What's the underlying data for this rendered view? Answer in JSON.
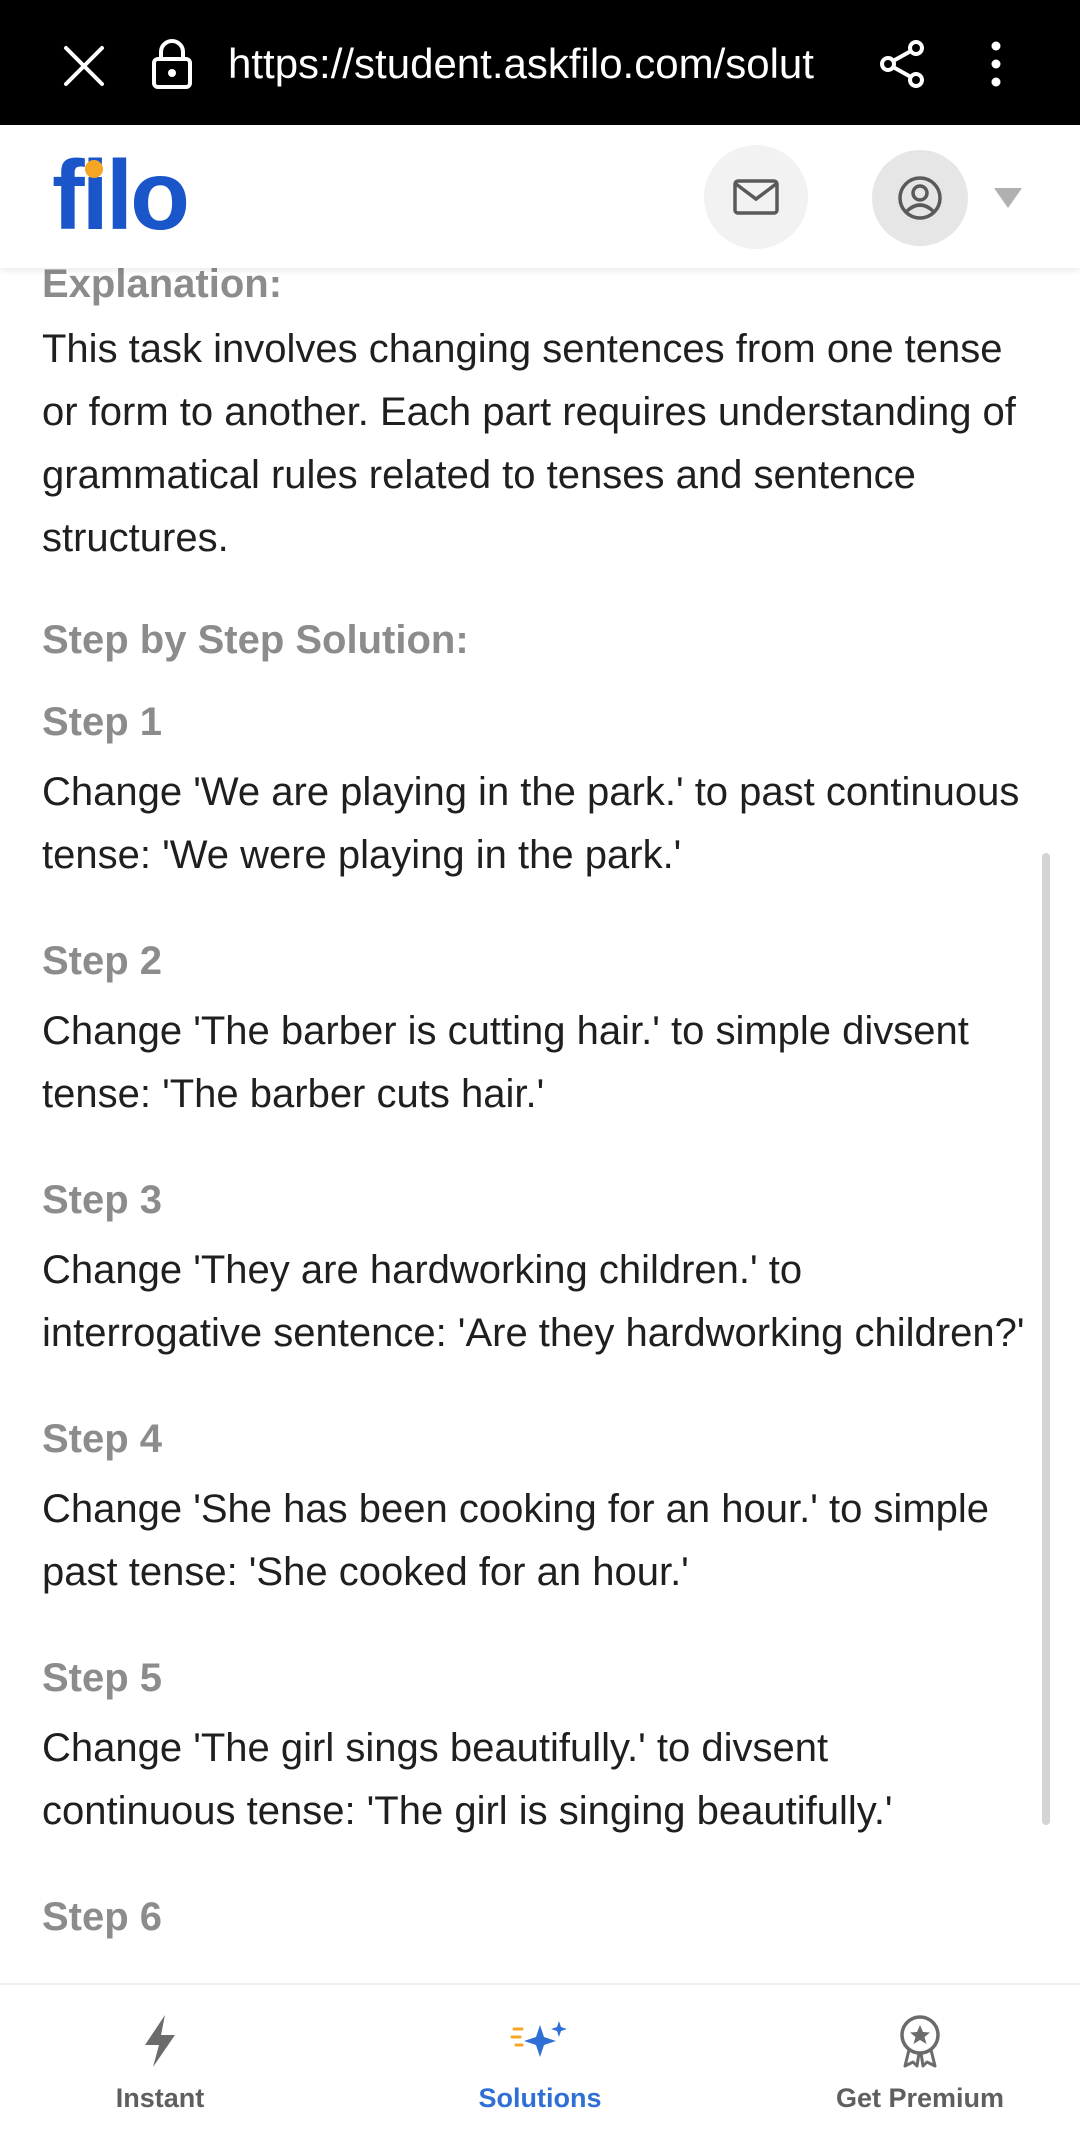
{
  "browser": {
    "url": "https://student.askfilo.com/solut"
  },
  "header": {
    "logo": "filo",
    "logo_prefix": "f",
    "logo_i": "i",
    "logo_suffix": "lo"
  },
  "content": {
    "explanation_label": "Explanation:",
    "explanation_text": "This task involves changing sentences from one tense or form to another. Each part requires understanding of grammatical rules related to tenses and sentence structures.",
    "steps_heading": "Step by Step Solution:",
    "steps": [
      {
        "label": "Step 1",
        "text": "Change 'We are playing in the park.' to past continuous tense: 'We were playing in the park.'"
      },
      {
        "label": "Step 2",
        "text": "Change 'The barber is cutting hair.' to simple divsent tense: 'The barber cuts hair.'"
      },
      {
        "label": "Step 3",
        "text": "Change 'They are hardworking children.' to interrogative sentence: 'Are they hardworking children?'"
      },
      {
        "label": "Step 4",
        "text": "Change 'She has been cooking for an hour.' to simple past tense: 'She cooked for an hour.'"
      },
      {
        "label": "Step 5",
        "text": "Change 'The girl sings beautifully.' to divsent continuous tense: 'The girl is singing beautifully.'"
      },
      {
        "label": "Step 6",
        "text": ""
      }
    ]
  },
  "bottom_nav": {
    "items": [
      {
        "label": "Instant",
        "icon": "lightning-icon"
      },
      {
        "label": "Solutions",
        "icon": "sparkles-icon",
        "active": true
      },
      {
        "label": "Get Premium",
        "icon": "award-badge-icon"
      }
    ]
  },
  "colors": {
    "brand_blue": "#1a56c9",
    "logo_dot": "#f5a623",
    "active_nav": "#2f6fd6",
    "heading_gray": "#8c8c8c"
  }
}
